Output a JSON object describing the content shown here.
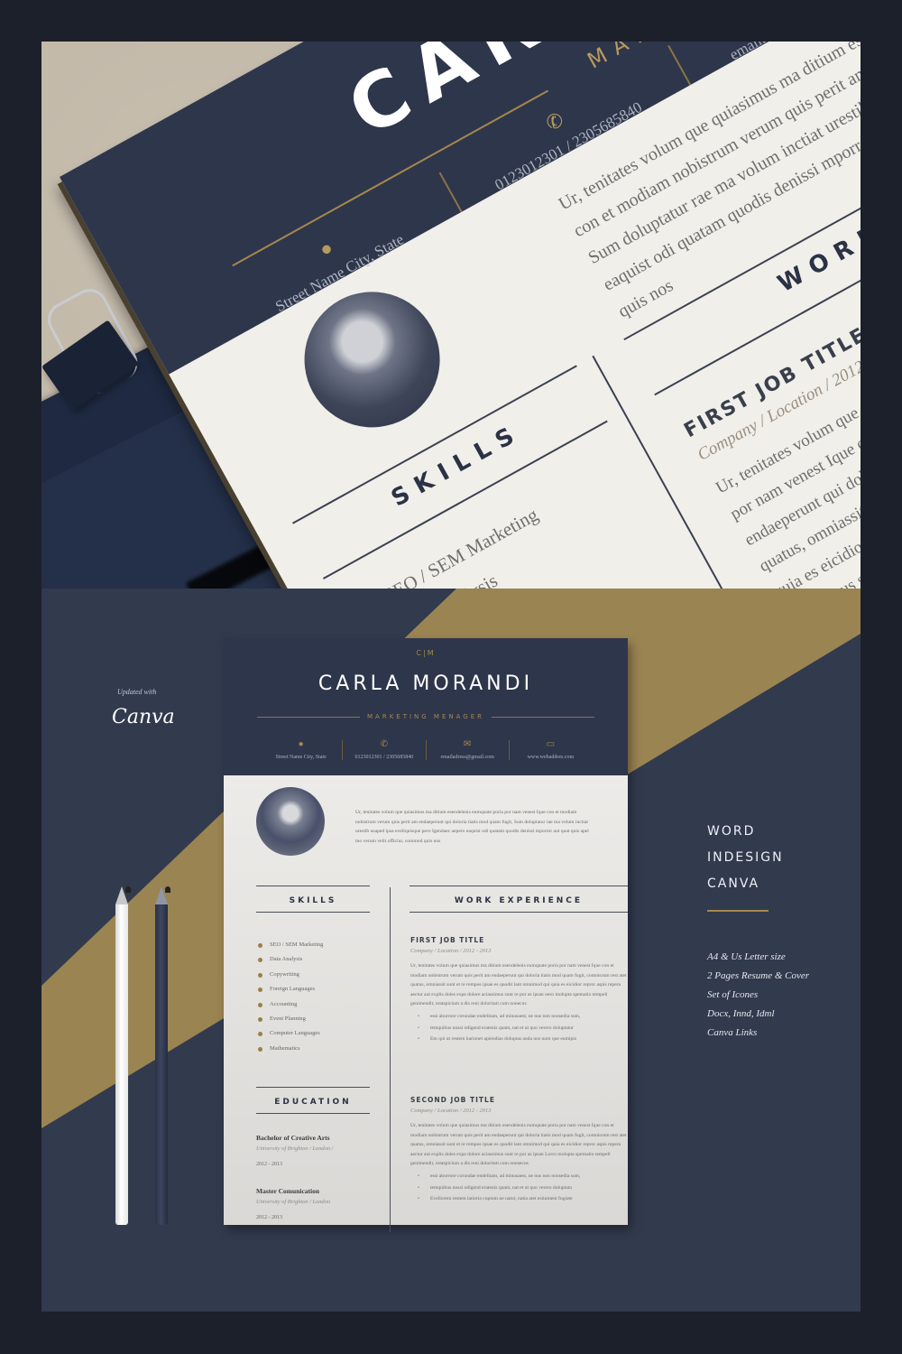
{
  "resume": {
    "monogram": "C|M",
    "name": "CARLA MORANDI",
    "name_partial": "CARLA MOR",
    "role": "MARKETING MENAGER",
    "contacts": [
      {
        "icon": "location-pin-icon",
        "glyph": "⬤",
        "text": "Street Name City, State"
      },
      {
        "icon": "phone-icon",
        "glyph": "✆",
        "text": "0123012301 / 2305685840"
      },
      {
        "icon": "envelope-icon",
        "glyph": "✉",
        "text": "emailadress@gmail.com"
      },
      {
        "icon": "web-card-icon",
        "glyph": "▭",
        "text": "www.webaddres.com"
      }
    ],
    "intro": "Ur, tenitates volum que quiasimus ma ditium esendelenis eumquate poria por nam venest Ique con et modiam nobistrum verum quis perit am endaeperunt qui doloria tiatis mod quam fugit, Sum doluptatur rae ma volum inctiat urestib usaped ipsa eveliquisque pero Igendaec aepero eaquist odi quatam quodis denissi mporror aut quat quis apel mo verum velit officiur, commod quis nos",
    "skills_heading": "SKILLS",
    "skills": [
      "SEO / SEM Marketing",
      "Data Analysis",
      "Copywriting",
      "Foreign Languages",
      "Accounting",
      "Event Planning",
      "Computer Languages",
      "Mathematics"
    ],
    "education_heading": "EDUCATION",
    "education_partial": "CATION",
    "education": [
      {
        "title": "Bachelor of Creative Arts",
        "school": "University of Brighton / London /",
        "years": "2012 - 2013"
      },
      {
        "title": "Master Comunication",
        "school": "University of Brighton / London",
        "years": "2012 - 2013"
      }
    ],
    "work_heading": "WORK EXPERIENCE",
    "jobs": [
      {
        "title": "FIRST JOB TITLE",
        "meta": "Company / Location / 2012 - 2013",
        "body": "Ur, tenitates volum que quiasimus ma ditium esendelenis eumquate poria por nam venest Ique con et modiam nobistrum verum quis perit am endaeperunt qui doloria tiatis mod quam fugit, comnisrum rest atet quatus, omniassit sunt et re rempos ipsae es quodit lant omnimod qui quia es eicidior repror aspis repera aectur aut explis doles expe dolore aciassimus sunt re por as ipsan oero molupta spematio tempeli genimendit, totaspicium a dis reni doloritati cum nonecus",
        "bullets": [
          "essi aborrore corundae endelitam, ad minusaest, ne nus non nonsedia sum,",
          "temquibus nossi odigend eratenis quam, nat et ut quo verero doluptatur",
          "Em qui ut restem harionet apiendias doluptas auda nos num que eumipis"
        ]
      },
      {
        "title": "SECOND JOB TITLE",
        "meta": "Company / Location / 2012 - 2013",
        "body": "Ur, tenitates volum que quiasimus ma ditium esendelenis eumquate poria por nam venest Ique con et modiam nobistrum verum quis perit am endaeperunt qui doloria tiatis mod quam fugit, comnisrum rest atet quatus, omniassit sunt et re rempos ipsae es quodit lant omnimod qui quia es eicidior repror aspis repera aectur aut explis doles expe dolore aciassimus sunt re por as ipsan Lorro molupta spernatio tempell genimendit, totaspicium a dis reni doloritati cum nonsecus",
        "bullets": [
          "essi aborrore corundae endelitam, ad minusaest, ne nus non nonsedia sum,",
          "temquibus nossi odigend eratenis quam, nat et ut quo verero doluptatu",
          "Evellorem restem latioria cuptum ne natur, natia atet estiument fugiate"
        ]
      }
    ]
  },
  "promo": {
    "updated_label": "Updated with",
    "canva_logo": "Canva",
    "formats": [
      "WORD",
      "INDESIGN",
      "CANVA"
    ],
    "features": [
      "A4 & Us Letter size",
      "2 Pages Resume & Cover",
      "Set of  Icones",
      "Docx, Innd, Idml",
      "Canva Links"
    ]
  },
  "colors": {
    "frame": "#1c202a",
    "navy": "#323a4e",
    "header_navy": "#2e364b",
    "gold": "#9a8452",
    "paper": "#f1efea",
    "desk": "#bfb5a4"
  }
}
